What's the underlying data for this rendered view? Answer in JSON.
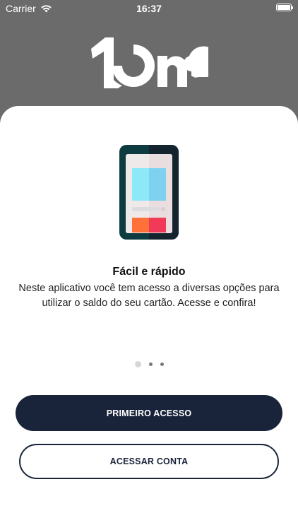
{
  "status_bar": {
    "carrier": "Carrier",
    "time": "16:37",
    "wifi_icon": "wifi-icon",
    "battery_icon": "battery-icon",
    "battery_level": 1.0
  },
  "brand": {
    "logo_text": "1ne",
    "header_color": "#6b6b6b"
  },
  "onboarding": {
    "illustration_icon": "smartphone-icon",
    "title": "Fácil e rápido",
    "description": "Neste aplicativo você tem acesso a diversas opções para utilizar o saldo do seu cartão. Acesse e confira!",
    "page_count": 3,
    "current_page": 1
  },
  "actions": {
    "primary_label": "PRIMEIRO ACESSO",
    "secondary_label": "ACESSAR CONTA",
    "button_color": "#19243a"
  }
}
